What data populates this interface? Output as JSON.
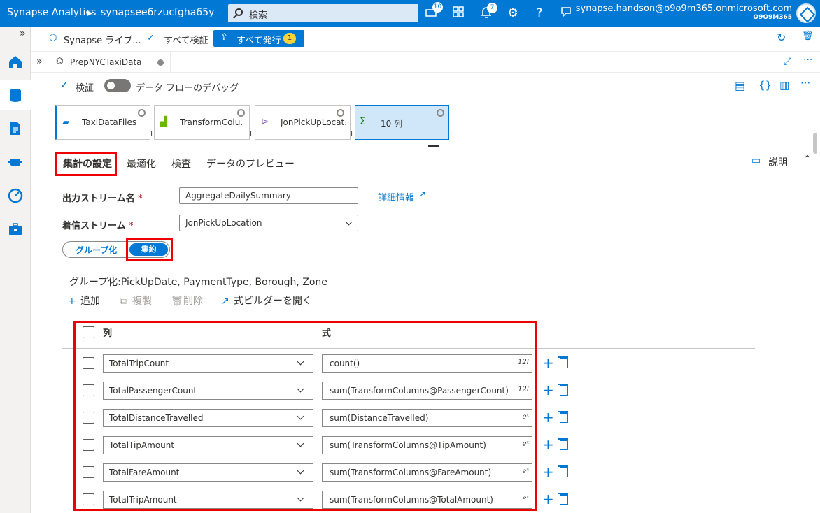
{
  "header": {
    "app_name": "Synapse Analytics",
    "breadcrumb_sep": "▶",
    "workspace": "synapsee6rzucfgha65y",
    "search_placeholder": "検索",
    "notifications_count": "10",
    "alerts_count": "7",
    "user_email": "synapse.handson@o9o9m365.onmicrosoft.com",
    "user_org": "O9O9M365"
  },
  "toolbar": {
    "collapse": "»",
    "library_label": "Synapse ライブ...",
    "validate_all_label": "すべて検証",
    "publish_all_label": "すべて発行",
    "publish_count": "1"
  },
  "tab": {
    "collapse": "»",
    "name": "PrepNYCTaxiData"
  },
  "dataflow_toolbar": {
    "validate_label": "検証",
    "debug_label": "データ フローのデバッグ"
  },
  "pipeline": {
    "nodes": [
      {
        "label": "TaxiDataFiles"
      },
      {
        "label": "TransformColu..."
      },
      {
        "label": "JonPickUpLocat..."
      },
      {
        "label": "10 列"
      }
    ]
  },
  "settings_tabs": {
    "aggregate_settings": "集計の設定",
    "optimize": "最適化",
    "inspect": "検査",
    "data_preview": "データのプレビュー",
    "description": "説明"
  },
  "form": {
    "output_stream_label": "出力ストリーム名",
    "output_stream_value": "AggregateDailySummary",
    "details_link": "詳細情報",
    "incoming_stream_label": "着信ストリーム",
    "incoming_stream_value": "JonPickUpLocation",
    "required_mark": "*",
    "group_by_label": "グループ化",
    "aggregates_label": "集約",
    "group_by_columns": "グループ化:PickUpDate, PaymentType, Borough, Zone"
  },
  "actions": {
    "add": "追加",
    "duplicate": "複製",
    "delete": "削除",
    "open_builder": "式ビルダーを開く"
  },
  "grid": {
    "column_header": "列",
    "expression_header": "式",
    "rows": [
      {
        "column": "TotalTripCount",
        "expression": "count()",
        "type": "12l"
      },
      {
        "column": "TotalPassengerCount",
        "expression": "sum(TransformColumns@PassengerCount)",
        "type": "12l"
      },
      {
        "column": "TotalDistanceTravelled",
        "expression": "sum(DistanceTravelled)",
        "type": "eˣ"
      },
      {
        "column": "TotalTipAmount",
        "expression": "sum(TransformColumns@TipAmount)",
        "type": "eˣ"
      },
      {
        "column": "TotalFareAmount",
        "expression": "sum(TransformColumns@FareAmount)",
        "type": "eˣ"
      },
      {
        "column": "TotalTripAmount",
        "expression": "sum(TransformColumns@TotalAmount)",
        "type": "eˣ"
      }
    ]
  },
  "colors": {
    "brand": "#0078d4",
    "highlight_box": "#ee0000",
    "node_active": "#cfe7f9"
  }
}
